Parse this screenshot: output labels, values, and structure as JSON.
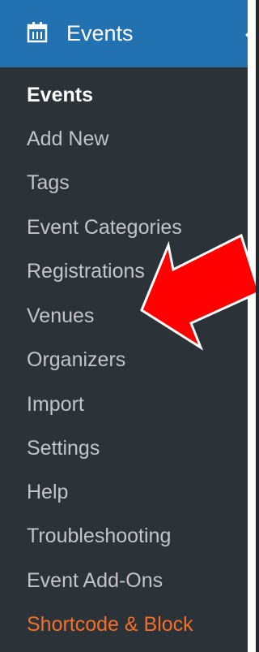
{
  "menu": {
    "title": "Events",
    "icon": "calendar-icon",
    "accent_color": "#2271b1",
    "highlight_color": "#f56e28",
    "items": [
      {
        "label": "Events",
        "current": true
      },
      {
        "label": "Add New"
      },
      {
        "label": "Tags"
      },
      {
        "label": "Event Categories"
      },
      {
        "label": "Registrations"
      },
      {
        "label": "Venues"
      },
      {
        "label": "Organizers"
      },
      {
        "label": "Import"
      },
      {
        "label": "Settings"
      },
      {
        "label": "Help"
      },
      {
        "label": "Troubleshooting"
      },
      {
        "label": "Event Add-Ons"
      },
      {
        "label": "Shortcode & Block",
        "highlight": true
      }
    ]
  },
  "annotation": {
    "icon": "red-arrow-icon",
    "color": "#ff0000",
    "target": "Venues"
  }
}
